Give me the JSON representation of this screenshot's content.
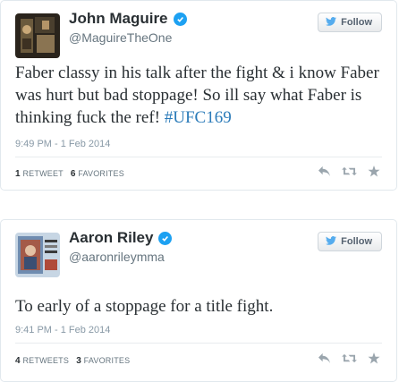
{
  "tweets": [
    {
      "name": "John Maguire",
      "handle": "@MaguireTheOne",
      "follow_label": "Follow",
      "text_main": "Faber classy in his talk after the fight & i know Faber was hurt but bad stoppage! So ill say what Faber is thinking fuck the ref! ",
      "hashtag": "#UFC169",
      "timestamp": "9:49 PM - 1 Feb 2014",
      "retweets_count": "1",
      "retweets_label": "RETWEET",
      "favorites_count": "6",
      "favorites_label": "FAVORITES"
    },
    {
      "name": "Aaron Riley",
      "handle": "@aaronrileymma",
      "follow_label": "Follow",
      "text_main": "To early of a stoppage for a title fight.",
      "hashtag": "",
      "timestamp": "9:41 PM - 1 Feb 2014",
      "retweets_count": "4",
      "retweets_label": "RETWEETS",
      "favorites_count": "3",
      "favorites_label": "FAVORITES"
    }
  ],
  "colors": {
    "link": "#2b7bb9",
    "verified": "#1da1f2",
    "muted": "#8899a6"
  },
  "icons": [
    "verified-icon",
    "twitter-bird-icon",
    "reply-icon",
    "retweet-icon",
    "favorite-icon"
  ]
}
